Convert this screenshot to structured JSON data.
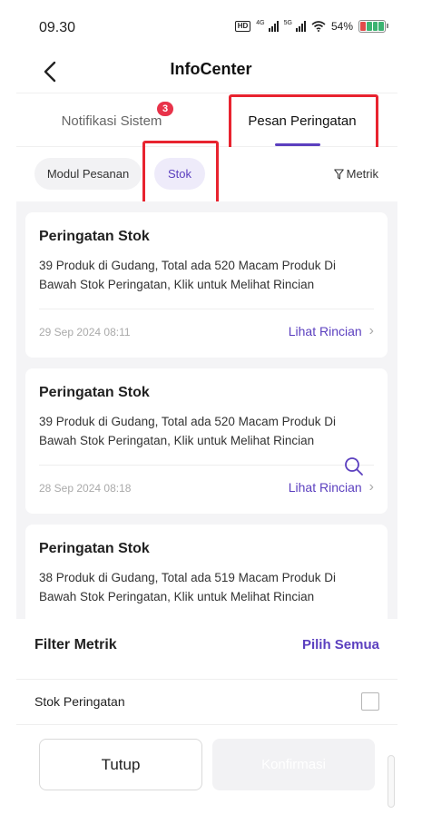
{
  "status_bar": {
    "time": "09.30",
    "hd_label": "HD",
    "net1": "4G",
    "net2": "5G",
    "battery_percent": "54%",
    "battery_level": 0.54
  },
  "header": {
    "title": "InfoCenter",
    "back_icon": "chevron-left-icon"
  },
  "tabs": [
    {
      "label": "Notifikasi Sistem",
      "badge": "3",
      "active": false
    },
    {
      "label": "Pesan Peringatan",
      "active": true
    }
  ],
  "chips": [
    {
      "label": "Modul Pesanan",
      "active": false
    },
    {
      "label": "Stok",
      "active": true
    }
  ],
  "metric_button": {
    "label": "Metrik",
    "icon": "filter-icon"
  },
  "cards": [
    {
      "title": "Peringatan Stok",
      "body": "39 Produk di Gudang, Total ada 520 Macam Produk Di Bawah Stok Peringatan, Klik untuk Melihat Rincian",
      "date": "29 Sep 2024 08:11",
      "link": "Lihat Rincian"
    },
    {
      "title": "Peringatan Stok",
      "body": "39 Produk di Gudang, Total ada 520 Macam Produk Di Bawah Stok Peringatan, Klik untuk Melihat Rincian",
      "date": "28 Sep 2024 08:18",
      "link": "Lihat Rincian"
    },
    {
      "title": "Peringatan Stok",
      "body": "38 Produk di Gudang, Total ada 519 Macam Produk Di Bawah Stok Peringatan, Klik untuk Melihat Rincian"
    }
  ],
  "filter_sheet": {
    "title": "Filter Metrik",
    "select_all": "Pilih Semua",
    "options": [
      {
        "label": "Stok Peringatan",
        "checked": false
      }
    ],
    "close_label": "Tutup",
    "confirm_label": "Konfirmasi"
  },
  "colors": {
    "accent": "#5b3fbf",
    "badge": "#e8334a",
    "highlight_box": "#e8232f",
    "list_background": "#f4f4f6"
  }
}
